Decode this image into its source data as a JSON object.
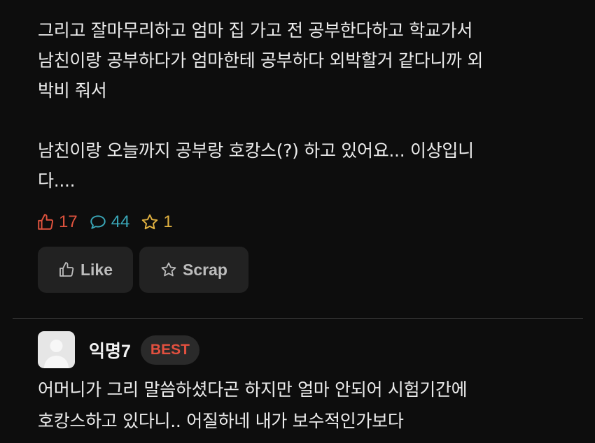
{
  "post": {
    "lines": [
      "그리고 잘마무리하고 엄마 집 가고 전 공부한다하고 학교가서",
      "남친이랑 공부하다가 엄마한테 공부하다 외박할거 같다니까 외",
      "박비 줘서",
      "남친이랑 오늘까지 공부랑 호캉스(?) 하고 있어요... 이상입니",
      "다...."
    ]
  },
  "stats": {
    "likes": "17",
    "comments": "44",
    "scraps": "1",
    "colors": {
      "like": "#e0533e",
      "comment": "#3aa7b8",
      "scrap": "#e3b341"
    }
  },
  "actions": {
    "like_label": "Like",
    "scrap_label": "Scrap"
  },
  "comment": {
    "nickname": "익명7",
    "badge": "BEST",
    "lines": [
      "어머니가 그리 말씀하셨다곤 하지만 얼마 안되어 시험기간에",
      "호캉스하고 있다니.. 어질하네 내가 보수적인가보다"
    ]
  },
  "icons": {
    "like": "thumbs-up-icon",
    "comment": "speech-bubble-icon",
    "scrap": "star-icon",
    "avatar": "default-avatar-icon"
  }
}
